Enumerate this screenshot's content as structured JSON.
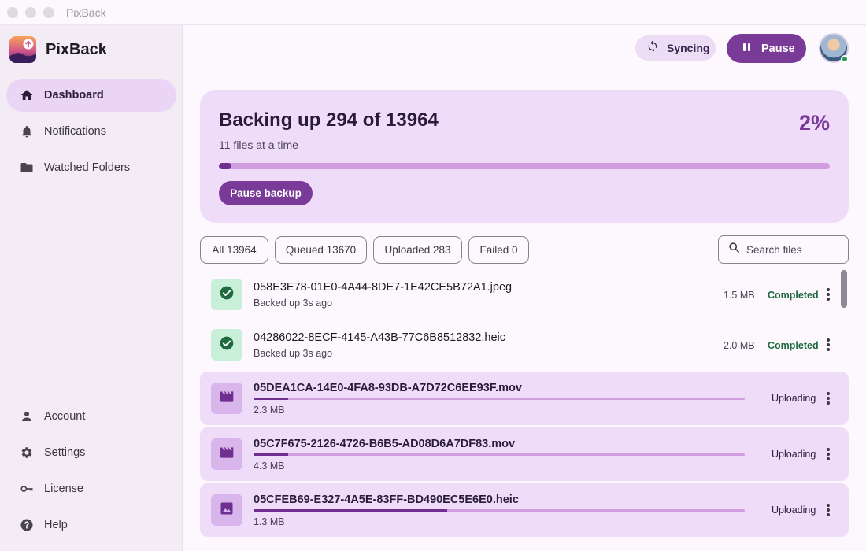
{
  "window": {
    "title": "PixBack"
  },
  "sidebar": {
    "brand": "PixBack",
    "nav": [
      {
        "label": "Dashboard",
        "icon": "home-icon",
        "active": true
      },
      {
        "label": "Notifications",
        "icon": "bell-icon"
      },
      {
        "label": "Watched Folders",
        "icon": "folder-icon"
      }
    ],
    "bottom_nav": [
      {
        "label": "Account",
        "icon": "person-icon"
      },
      {
        "label": "Settings",
        "icon": "gear-icon"
      },
      {
        "label": "License",
        "icon": "key-icon"
      },
      {
        "label": "Help",
        "icon": "help-icon"
      }
    ]
  },
  "topbar": {
    "sync_label": "Syncing",
    "pause_label": "Pause"
  },
  "progress": {
    "title": "Backing up 294 of 13964",
    "subtitle": "11 files at a time",
    "percent_label": "2%",
    "fraction": 0.02,
    "button_label": "Pause backup"
  },
  "filters": [
    "All 13964",
    "Queued 13670",
    "Uploaded 283",
    "Failed 0"
  ],
  "search": {
    "placeholder": "Search files"
  },
  "files": [
    {
      "name": "058E3E78-01E0-4A44-8DE7-1E42CE5B72A1.jpeg",
      "sub": "Backed up 3s ago",
      "size": "1.5 MB",
      "status": "Completed",
      "icon": "check-icon"
    },
    {
      "name": "04286022-8ECF-4145-A43B-77C6B8512832.heic",
      "sub": "Backed up 3s ago",
      "size": "2.0 MB",
      "status": "Completed",
      "icon": "check-icon"
    },
    {
      "name": "05DEA1CA-14E0-4FA8-93DB-A7D72C6EE93F.mov",
      "size": "2.3 MB",
      "status": "Uploading",
      "progress": 0.07,
      "icon": "movie-icon"
    },
    {
      "name": "05C7F675-2126-4726-B6B5-AD08D6A7DF83.mov",
      "size": "4.3 MB",
      "status": "Uploading",
      "progress": 0.07,
      "icon": "movie-icon"
    },
    {
      "name": "05CFEB69-E327-4A5E-83FF-BD490EC5E6E0.heic",
      "size": "1.3 MB",
      "status": "Uploading",
      "progress": 0.395,
      "icon": "image-icon"
    }
  ],
  "colors": {
    "accent": "#7a3b98",
    "card": "#efdcf9",
    "success": "#1f6b3f"
  }
}
